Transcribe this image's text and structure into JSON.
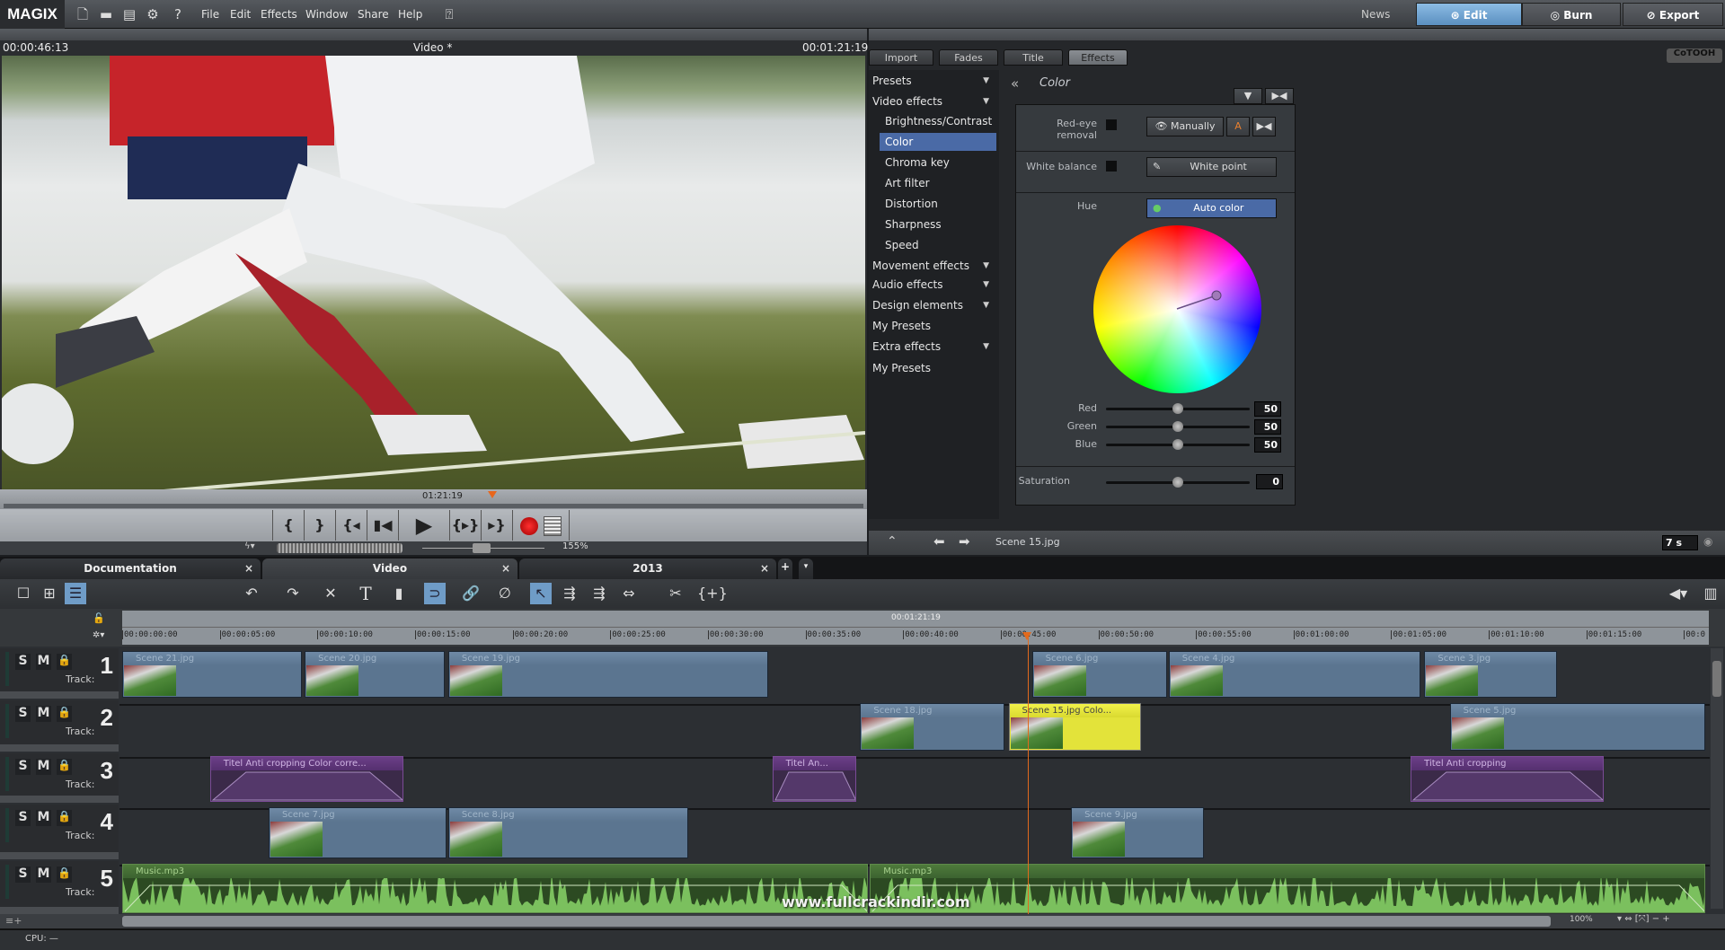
{
  "app": {
    "logo": "MAGIX",
    "menu": [
      "File",
      "Edit",
      "Effects",
      "Window",
      "Share",
      "Help"
    ],
    "news": "News",
    "modes": [
      "Edit",
      "Burn",
      "Export"
    ],
    "brand": "CoTOOH"
  },
  "preview": {
    "timecode_left": "00:00:46:13",
    "title": "Video *",
    "timecode_right": "00:01:21:19",
    "scrub_time": "01:21:19",
    "zoom": "155%"
  },
  "effects": {
    "tabs": [
      "Import",
      "Fades",
      "Title",
      "Effects"
    ],
    "active_tab": "Effects",
    "list": [
      {
        "label": "Presets",
        "arrow": true
      },
      {
        "label": "Video effects",
        "arrow": true
      },
      {
        "label": "Brightness/Contrast",
        "sub": true
      },
      {
        "label": "Color",
        "sub": true,
        "selected": true
      },
      {
        "label": "Chroma key",
        "sub": true
      },
      {
        "label": "Art filter",
        "sub": true
      },
      {
        "label": "Distortion",
        "sub": true
      },
      {
        "label": "Sharpness",
        "sub": true
      },
      {
        "label": "Speed",
        "sub": true
      },
      {
        "label": "Movement effects",
        "arrow": true
      },
      {
        "label": "Audio effects",
        "arrow": true
      },
      {
        "label": "Design elements",
        "arrow": true
      },
      {
        "label": "My Presets"
      },
      {
        "label": "Extra effects",
        "arrow": true
      },
      {
        "label": "My Presets"
      }
    ],
    "panel_title": "Color",
    "red_eye_label": "Red-eye removal",
    "manually": "Manually",
    "white_balance_label": "White balance",
    "white_point": "White point",
    "hue_label": "Hue",
    "auto_color": "Auto color",
    "sliders": [
      {
        "label": "Red",
        "value": "50"
      },
      {
        "label": "Green",
        "value": "50"
      },
      {
        "label": "Blue",
        "value": "50"
      }
    ],
    "saturation": {
      "label": "Saturation",
      "value": "0"
    },
    "footer_file": "Scene 15.jpg",
    "duration": "7 s"
  },
  "timeline": {
    "tabs": [
      {
        "label": "Documentation"
      },
      {
        "label": "Video",
        "active": true
      },
      {
        "label": "2013"
      }
    ],
    "range_label": "00:01:21:19",
    "ruler": [
      "00:00:00:00",
      "00:00:05:00",
      "00:00:10:00",
      "00:00:15:00",
      "00:00:20:00",
      "00:00:25:00",
      "00:00:30:00",
      "00:00:35:00",
      "00:00:40:00",
      "00:00:45:00",
      "00:00:50:00",
      "00:00:55:00",
      "00:01:00:00",
      "00:01:05:00",
      "00:01:10:00",
      "00:01:15:00",
      "00:0"
    ],
    "playhead_seconds": 46.4,
    "track_label": "Track:",
    "tracks": [
      {
        "number": "1",
        "clips": [
          {
            "name": "Scene 21.jpg",
            "start": 0,
            "end": 9.3
          },
          {
            "name": "Scene 20.jpg",
            "start": 9.35,
            "end": 16.6
          },
          {
            "name": "Scene 19.jpg",
            "start": 16.7,
            "end": 33.2
          },
          {
            "name": "Scene 6.jpg",
            "start": 46.6,
            "end": 53.6
          },
          {
            "name": "Scene 4.jpg",
            "start": 53.6,
            "end": 66.6
          },
          {
            "name": "Scene 3.jpg",
            "start": 66.7,
            "end": 73.6
          }
        ]
      },
      {
        "number": "2",
        "clips": [
          {
            "name": "Scene 18.jpg",
            "start": 37.8,
            "end": 45.3
          },
          {
            "name": "Scene 15.jpg   Colo...",
            "start": 45.4,
            "end": 52.3,
            "type": "yellow"
          },
          {
            "name": "Scene 5.jpg",
            "start": 68,
            "end": 81.2
          }
        ]
      },
      {
        "number": "3",
        "clips": [
          {
            "name": "Titel   Anti cropping  Color corre...",
            "start": 4.5,
            "end": 14.5,
            "type": "title"
          },
          {
            "name": "Titel   An...",
            "start": 33.3,
            "end": 37.7,
            "type": "title"
          },
          {
            "name": "Titel   Anti cropping",
            "start": 66,
            "end": 76,
            "type": "title"
          }
        ]
      },
      {
        "number": "4",
        "clips": [
          {
            "name": "Scene 7.jpg",
            "start": 7.5,
            "end": 16.7
          },
          {
            "name": "Scene 8.jpg",
            "start": 16.7,
            "end": 29.1
          },
          {
            "name": "Scene 9.jpg",
            "start": 48.6,
            "end": 55.5
          }
        ]
      },
      {
        "number": "5",
        "clips": [
          {
            "name": "Music.mp3",
            "start": 0,
            "end": 38.3,
            "type": "audio"
          },
          {
            "name": "Music.mp3",
            "start": 38.3,
            "end": 81.2,
            "type": "audio"
          }
        ]
      }
    ],
    "zoom": "100%",
    "watermark": "www.fullcrackindir.com"
  },
  "status": {
    "cpu": "CPU: —"
  }
}
